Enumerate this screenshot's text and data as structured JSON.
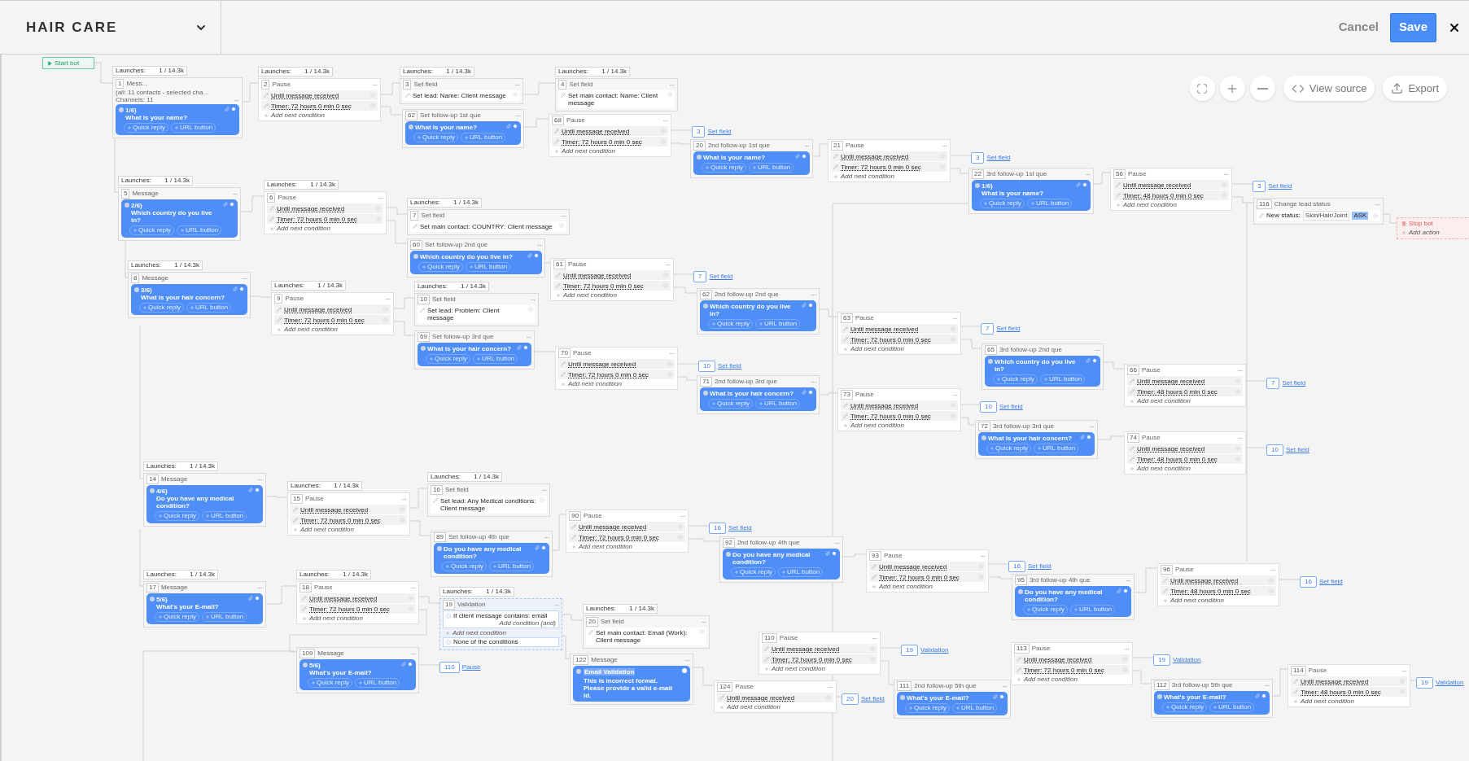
{
  "header": {
    "title": "HAIR CARE",
    "cancel": "Cancel",
    "save": "Save"
  },
  "toolbar": {
    "view_source": "View source",
    "export": "Export"
  },
  "nodes": [
    {
      "kind": "start",
      "label": "Start bot"
    },
    {
      "kind": "message",
      "launches": {
        "label": "Launches:",
        "value": "1 / 14.3k"
      },
      "number": "1",
      "title": "Mess...",
      "audience": "(all: 11 contacts - selected cha...",
      "channels": "Channels: 11",
      "step": "1/6)",
      "question": "What is your name?",
      "buttons": [
        "Quick reply",
        "URL button"
      ]
    },
    {
      "kind": "pause",
      "launches": {
        "label": "Launches:",
        "value": "1 / 14.3k"
      },
      "number": "2",
      "title": "Pause",
      "conditions": [
        "Until message received",
        "Timer: 72 hours 0 min 0 sec"
      ],
      "add": "Add next condition"
    },
    {
      "kind": "setfield",
      "launches": {
        "label": "Launches:",
        "value": "1 / 14.3k"
      },
      "number": "3",
      "title": "Set field",
      "text": "Set lead: Name: Client message"
    },
    {
      "kind": "setfield",
      "launches": {
        "label": "Launches:",
        "value": "1 / 14.3k"
      },
      "number": "4",
      "title": "Set field",
      "text": "Set main contact: Name: Client message"
    },
    {
      "kind": "message",
      "number": "62",
      "title": "Set follow-up 1st que",
      "question": "What is your name?",
      "buttons": [
        "Quick reply",
        "URL button"
      ]
    },
    {
      "kind": "pause",
      "number": "68",
      "title": "Pause",
      "conditions": [
        "Until message received",
        "Timer: 72 hours 0 min 0 sec"
      ],
      "add": "Add next condition"
    },
    {
      "kind": "link",
      "number": "3",
      "label": "Set field"
    },
    {
      "kind": "message",
      "number": "20",
      "title": "2nd follow-up 1st que",
      "question": "What is your name?",
      "buttons": [
        "Quick reply",
        "URL button"
      ]
    },
    {
      "kind": "pause",
      "number": "21",
      "title": "Pause",
      "conditions": [
        "Until message received",
        "Timer: 72 hours 0 min 0 sec"
      ],
      "add": "Add next condition"
    },
    {
      "kind": "link",
      "number": "3",
      "label": "Set field"
    },
    {
      "kind": "message",
      "number": "22",
      "title": "3rd follow-up 1st que",
      "step": "1/6)",
      "question": "What is your name?",
      "buttons": [
        "Quick reply",
        "URL button"
      ]
    },
    {
      "kind": "pause",
      "number": "56",
      "title": "Pause",
      "conditions": [
        "Until message received",
        "Timer: 48 hours 0 min 0 sec"
      ],
      "add": "Add next condition"
    },
    {
      "kind": "link",
      "number": "3",
      "label": "Set field"
    },
    {
      "kind": "message",
      "launches": {
        "label": "Launches:",
        "value": "1 / 14.3k"
      },
      "number": "5",
      "title": "Message",
      "step": "2/6)",
      "question": "Which country do you live in?",
      "buttons": [
        "Quick reply",
        "URL button"
      ]
    },
    {
      "kind": "pause",
      "launches": {
        "label": "Launches:",
        "value": "1 / 14.3k"
      },
      "number": "6",
      "title": "Pause",
      "conditions": [
        "Until message received",
        "Timer: 72 hours 0 min 0 sec"
      ],
      "add": "Add next condition"
    },
    {
      "kind": "setfield",
      "launches": {
        "label": "Launches:",
        "value": "1 / 14.3k"
      },
      "number": "7",
      "title": "Set field",
      "text": "Set main contact: COUNTRY: Client message"
    },
    {
      "kind": "status",
      "number": "116",
      "title": "Change lead status",
      "label": "New status:",
      "value": "Skin/Hair/Joint",
      "badge": "ASK"
    },
    {
      "kind": "stop",
      "label": "Stop bot",
      "add": "Add action"
    },
    {
      "kind": "message",
      "number": "60",
      "title": "Set follow-up 2nd que",
      "question": "Which country do you live in?",
      "buttons": [
        "Quick reply",
        "URL button"
      ]
    },
    {
      "kind": "pause",
      "number": "61",
      "title": "Pause",
      "conditions": [
        "Until message received",
        "Timer: 72 hours 0 min 0 sec"
      ],
      "add": "Add next condition"
    },
    {
      "kind": "link",
      "number": "7",
      "label": "Set field"
    },
    {
      "kind": "message",
      "number": "62",
      "title": "2nd follow-up 2nd que",
      "question": "Which country do you live in?",
      "buttons": [
        "Quick reply",
        "URL button"
      ]
    },
    {
      "kind": "pause",
      "number": "63",
      "title": "Pause",
      "conditions": [
        "Until message received",
        "Timer: 72 hours 0 min 0 sec"
      ],
      "add": "Add next condition"
    },
    {
      "kind": "link",
      "number": "7",
      "label": "Set field"
    },
    {
      "kind": "message",
      "number": "65",
      "title": "3rd follow-up 2nd que",
      "question": "Which country do you live in?",
      "buttons": [
        "Quick reply",
        "URL button"
      ]
    },
    {
      "kind": "pause",
      "number": "66",
      "title": "Pause",
      "conditions": [
        "Until message received",
        "Timer: 48 hours 0 min 0 sec"
      ],
      "add": "Add next condition"
    },
    {
      "kind": "link",
      "number": "7",
      "label": "Set field"
    },
    {
      "kind": "message",
      "launches": {
        "label": "Launches:",
        "value": "1 / 14.3k"
      },
      "number": "8",
      "title": "Message",
      "step": "3/6)",
      "question": "What is your hair concern?",
      "buttons": [
        "Quick reply",
        "URL button"
      ]
    },
    {
      "kind": "pause",
      "launches": {
        "label": "Launches:",
        "value": "1 / 14.3k"
      },
      "number": "9",
      "title": "Pause",
      "conditions": [
        "Until message received",
        "Timer: 72 hours 0 min 0 sec"
      ],
      "add": "Add next condition"
    },
    {
      "kind": "setfield",
      "launches": {
        "label": "Launches:",
        "value": "1 / 14.3k"
      },
      "number": "10",
      "title": "Set field",
      "text": "Set lead: Problem: Client message"
    },
    {
      "kind": "message",
      "number": "69",
      "title": "Set follow-up 3rd que",
      "question": "What is your hair concern?",
      "buttons": [
        "Quick reply",
        "URL button"
      ]
    },
    {
      "kind": "pause",
      "number": "70",
      "title": "Pause",
      "conditions": [
        "Until message received",
        "Timer: 72 hours 0 min 0 sec"
      ],
      "add": "Add next condition"
    },
    {
      "kind": "link",
      "number": "10",
      "label": "Set field"
    },
    {
      "kind": "message",
      "number": "71",
      "title": "2nd follow-up 3rd que",
      "question": "What is your hair concern?",
      "buttons": [
        "Quick reply",
        "URL button"
      ]
    },
    {
      "kind": "pause",
      "number": "73",
      "title": "Pause",
      "conditions": [
        "Until message received",
        "Timer: 72 hours 0 min 0 sec"
      ],
      "add": "Add next condition"
    },
    {
      "kind": "link",
      "number": "10",
      "label": "Set field"
    },
    {
      "kind": "message",
      "number": "72",
      "title": "3rd follow-up 3rd que",
      "question": "What is your hair concern?",
      "buttons": [
        "Quick reply",
        "URL button"
      ]
    },
    {
      "kind": "pause",
      "number": "74",
      "title": "Pause",
      "conditions": [
        "Until message received",
        "Timer: 48 hours 0 min 0 sec"
      ],
      "add": "Add next condition"
    },
    {
      "kind": "link",
      "number": "10",
      "label": "Set field"
    },
    {
      "kind": "message",
      "launches": {
        "label": "Launches:",
        "value": "1 / 14.3k"
      },
      "number": "14",
      "title": "Message",
      "step": "4/6)",
      "question": "Do you have any medical condition?",
      "buttons": [
        "Quick reply",
        "URL button"
      ]
    },
    {
      "kind": "pause",
      "launches": {
        "label": "Launches:",
        "value": "1 / 14.3k"
      },
      "number": "15",
      "title": "Pause",
      "conditions": [
        "Until message received",
        "Timer: 72 hours 0 min 0 sec"
      ],
      "add": "Add next condition"
    },
    {
      "kind": "setfield",
      "launches": {
        "label": "Launches:",
        "value": "1 / 14.3k"
      },
      "number": "16",
      "title": "Set field",
      "text": "Set lead: Any Medical conditions: Client message"
    },
    {
      "kind": "message",
      "number": "89",
      "title": "Set follow-up 4th que",
      "question": "Do you have any medical condition?",
      "buttons": [
        "Quick reply",
        "URL button"
      ]
    },
    {
      "kind": "pause",
      "number": "90",
      "title": "Pause",
      "conditions": [
        "Until message received",
        "Timer: 72 hours 0 min 0 sec"
      ],
      "add": "Add next condition"
    },
    {
      "kind": "link",
      "number": "16",
      "label": "Set field"
    },
    {
      "kind": "message",
      "number": "92",
      "title": "2nd follow-up 4th que",
      "question": "Do you have any medical condition?",
      "buttons": [
        "Quick reply",
        "URL button"
      ]
    },
    {
      "kind": "pause",
      "number": "93",
      "title": "Pause",
      "conditions": [
        "Until message received",
        "Timer: 72 hours 0 min 0 sec"
      ],
      "add": "Add next condition"
    },
    {
      "kind": "link",
      "number": "16",
      "label": "Set field"
    },
    {
      "kind": "message",
      "number": "95",
      "title": "3rd follow-up 4th que",
      "question": "Do you have any medical condition?",
      "buttons": [
        "Quick reply",
        "URL button"
      ]
    },
    {
      "kind": "pause",
      "number": "96",
      "title": "Pause",
      "conditions": [
        "Until message received",
        "Timer: 48 hours 0 min 0 sec"
      ],
      "add": "Add next condition"
    },
    {
      "kind": "link",
      "number": "16",
      "label": "Set field"
    },
    {
      "kind": "message",
      "launches": {
        "label": "Launches:",
        "value": "1 / 14.3k"
      },
      "number": "17",
      "title": "Message",
      "step": "5/6)",
      "question": "What's your E-mail?",
      "buttons": [
        "Quick reply",
        "URL button"
      ]
    },
    {
      "kind": "pause",
      "launches": {
        "label": "Launches:",
        "value": "1 / 14.3k"
      },
      "number": "18",
      "title": "Pause",
      "conditions": [
        "Until message received",
        "Timer: 72 hours 0 min 0 sec"
      ],
      "add": "Add next condition"
    },
    {
      "kind": "validation",
      "launches": {
        "label": "Launches:",
        "value": "1 / 14.3k"
      },
      "number": "19",
      "title": "Validation",
      "condition": "If client message contains: email",
      "sub": "Add condition (and)",
      "add": "Add next condition",
      "fallback": "None of the conditions"
    },
    {
      "kind": "setfield",
      "launches": {
        "label": "Launches:",
        "value": "1 / 14.3k"
      },
      "number": "20",
      "title": "Set field",
      "text": "Set main contact: Email (Work): Client message"
    },
    {
      "kind": "message",
      "number": "109",
      "title": "Message",
      "step": "5/6)",
      "question": "What's your E-mail?",
      "buttons": [
        "Quick reply",
        "URL button"
      ]
    },
    {
      "kind": "link",
      "number": "110",
      "label": "Pause"
    },
    {
      "kind": "text_message",
      "number": "122",
      "title": "Message",
      "highlight": "Email Validation",
      "body": "This is incorrect format. Please provide a valid e-mail id."
    },
    {
      "kind": "pause",
      "number": "110",
      "title": "Pause",
      "conditions": [
        "Until message received",
        "Timer: 72 hours 0 min 0 sec"
      ],
      "add": "Add next condition"
    },
    {
      "kind": "link",
      "number": "19",
      "label": "Validation"
    },
    {
      "kind": "pause",
      "number": "124",
      "title": "Pause",
      "conditions": [
        "Until message received"
      ],
      "add": "Add next condition"
    },
    {
      "kind": "link",
      "number": "20",
      "label": "Set field"
    },
    {
      "kind": "message",
      "number": "111",
      "title": "2nd follow-up 5th que",
      "question": "What's your E-mail?",
      "buttons": [
        "Quick reply",
        "URL button"
      ]
    },
    {
      "kind": "pause",
      "number": "113",
      "title": "Pause",
      "conditions": [
        "Until message received",
        "Timer: 72 hours 0 min 0 sec"
      ],
      "add": "Add next condition"
    },
    {
      "kind": "link",
      "number": "19",
      "label": "Validation"
    },
    {
      "kind": "message",
      "number": "112",
      "title": "3rd follow-up 5th que",
      "question": "What's your E-mail?",
      "buttons": [
        "Quick reply",
        "URL button"
      ]
    },
    {
      "kind": "pause",
      "number": "114",
      "title": "Pause",
      "conditions": [
        "Until message received",
        "Timer: 48 hours 0 min 0 sec"
      ],
      "add": "Add next condition"
    },
    {
      "kind": "link",
      "number": "19",
      "label": "Validation"
    }
  ]
}
